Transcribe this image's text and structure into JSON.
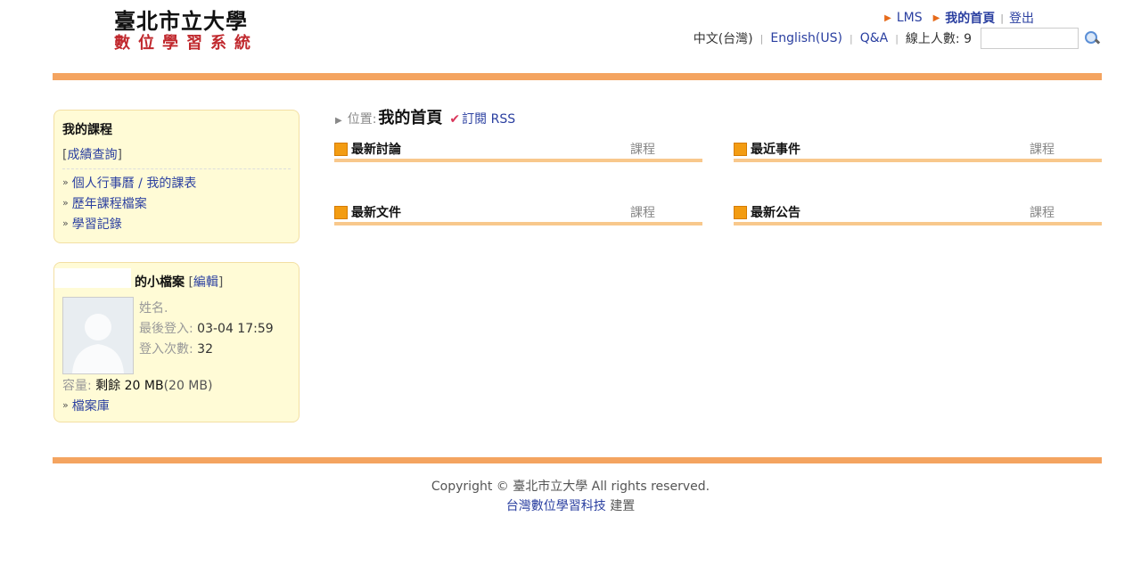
{
  "header": {
    "logo_line1": "臺北市立大學",
    "logo_line2": "數位學習系統",
    "links": {
      "lms": "LMS",
      "home": "我的首頁",
      "logout": "登出"
    },
    "lang": {
      "zh": "中文(台灣)",
      "en": "English(US)",
      "qa": "Q&A",
      "online": "線上人數: 9"
    },
    "search_value": ""
  },
  "courses_box": {
    "title": "我的課程",
    "grades_link": "成績查詢",
    "items": [
      "個人行事曆 / 我的課表",
      "歷年課程檔案",
      "學習記錄"
    ]
  },
  "profile_box": {
    "title": "的小檔案",
    "edit_link": "編輯",
    "name_label": "姓名.",
    "last_login_label": "最後登入:",
    "last_login_value": "03-04 17:59",
    "login_count_label": "登入次數:",
    "login_count_value": "32",
    "capacity_label": "容量:",
    "capacity_remaining": "剩餘 20 MB",
    "capacity_total": "(20 MB)",
    "files_link": "檔案庫"
  },
  "main": {
    "location_label": "位置:",
    "location_title": "我的首頁",
    "rss_label": "訂閱 RSS",
    "panels": [
      {
        "title": "最新討論",
        "link": "課程"
      },
      {
        "title": "最近事件",
        "link": "課程"
      },
      {
        "title": "最新文件",
        "link": "課程"
      },
      {
        "title": "最新公告",
        "link": "課程"
      }
    ]
  },
  "footer": {
    "copyright": "Copyright © 臺北市立大學 All rights reserved.",
    "builder_link": "台灣數位學習科技",
    "builder_suffix": " 建置"
  },
  "colors": {
    "accent_orange": "#f4a460",
    "link_blue": "#2a3fa0",
    "box_bg": "#fffbd6"
  }
}
